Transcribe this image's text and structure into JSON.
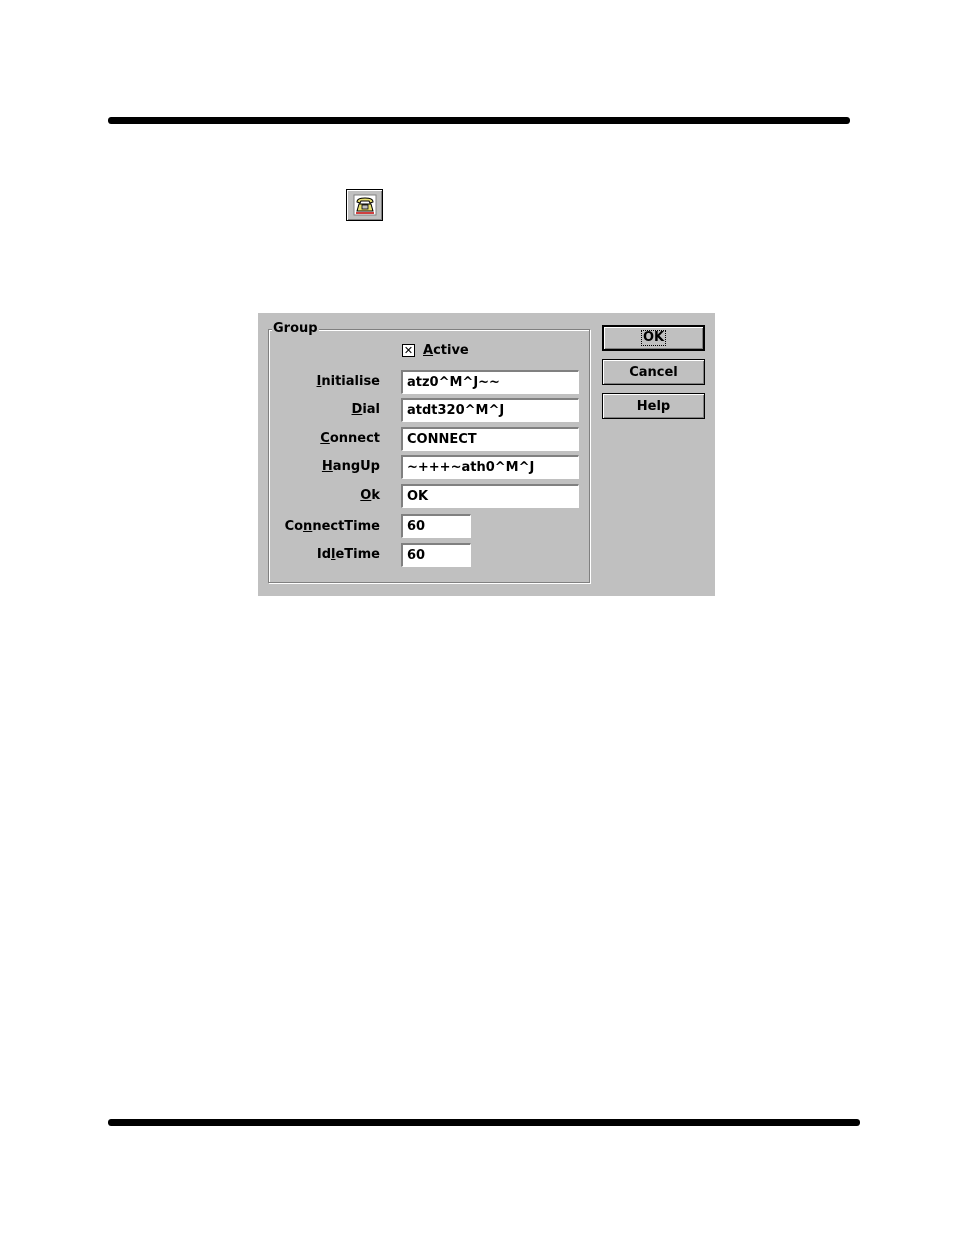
{
  "toolbar": {
    "icon": "telephone-icon"
  },
  "dialog": {
    "group_label": "Group",
    "active": {
      "label_first": "A",
      "label_rest": "ctive",
      "checked_mark": "✕"
    },
    "fields": [
      {
        "label_pre": "",
        "label_key": "I",
        "label_post": "nitialise",
        "value": "atz0^M^J~~"
      },
      {
        "label_pre": "",
        "label_key": "D",
        "label_post": "ial",
        "value": "atdt320^M^J"
      },
      {
        "label_pre": "",
        "label_key": "C",
        "label_post": "onnect",
        "value": "CONNECT"
      },
      {
        "label_pre": "",
        "label_key": "H",
        "label_post": "angUp",
        "value": "~+++~ath0^M^J"
      },
      {
        "label_pre": "",
        "label_key": "O",
        "label_post": "k",
        "value": "OK"
      },
      {
        "label_pre": "Co",
        "label_key": "n",
        "label_post": "nectTime",
        "value": "60"
      },
      {
        "label_pre": "Id",
        "label_key": "l",
        "label_post": "eTime",
        "value": "60"
      }
    ],
    "buttons": {
      "ok": "OK",
      "cancel": "Cancel",
      "help": "Help"
    }
  }
}
